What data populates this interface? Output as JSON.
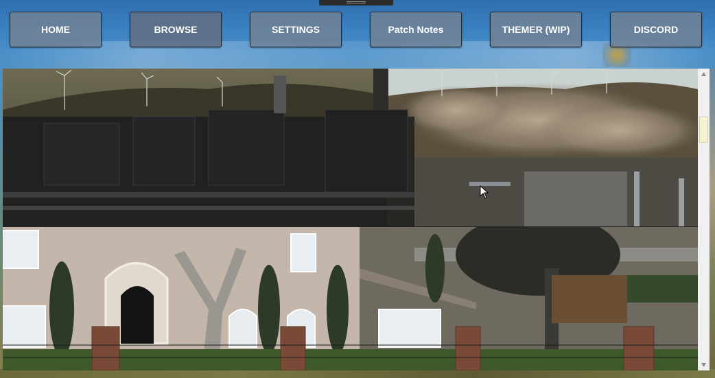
{
  "nav": {
    "buttons": [
      {
        "label": "HOME"
      },
      {
        "label": "BROWSE"
      },
      {
        "label": "SETTINGS"
      },
      {
        "label": "Patch Notes"
      },
      {
        "label": "THEMER (WIP)"
      },
      {
        "label": "DISCORD"
      }
    ],
    "active": "BROWSE"
  },
  "gallery": {
    "images": [
      {
        "name": "power-plant-screenshot"
      },
      {
        "name": "house-street-screenshot"
      }
    ]
  },
  "colors": {
    "button_bg": "#6e8296",
    "button_border": "#1e2a36",
    "button_text": "#ffffff",
    "scrollbar_track": "#f0f0f0",
    "scrollbar_thumb": "#f7f2cf"
  },
  "icons": {
    "scroll_up": "triangle-up",
    "scroll_down": "triangle-down"
  }
}
